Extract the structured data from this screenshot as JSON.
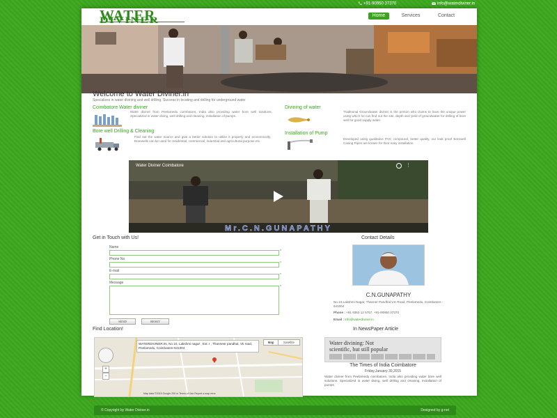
{
  "topbar": {
    "phone": "+91-90950 37370",
    "email": "info@waterdiviner.in",
    "phone_icon": "phone-icon",
    "email_icon": "mail-icon"
  },
  "logo": {
    "line1": "WATER",
    "line2": "DIVINER"
  },
  "nav": [
    {
      "label": "Home",
      "active": true
    },
    {
      "label": "Services",
      "active": false
    },
    {
      "label": "Contact",
      "active": false
    }
  ],
  "welcome": {
    "title": "Welcome to Water Diviner.in",
    "tagline": "Specializes in water divining and well drilling. Success in locating and drilling for underground water"
  },
  "features": [
    {
      "title": "Coimbatore Water diviner",
      "text": "Water diviner from Peelamedu coimbatore, India also providing water bore well solutions. Specialized in water diving, well drilling and cleaning, installation of pumps."
    },
    {
      "title": "Divining of water",
      "text": "Traditional Groundwater diviner is the person who claims to have the unique power using which he can find out the site, depth and yield of groundwater for drilling of bore well for good supply water."
    },
    {
      "title": "Bore well Drilling & Cleaning",
      "text": "Find out the water source and give a better solution to utilize it properly and economically. Borewells can be used for residential, commercial, industrial and agricultural purpose etc."
    },
    {
      "title": "Installation of Pump",
      "text": "Developed using qualitative PVC compound, better quality, our leak proof Borewell Casing Pipes are known for their easy installation."
    }
  ],
  "video": {
    "title": "Water Diviner Coimbatore",
    "caption": "Mr.C.N.GUNAPATHY"
  },
  "contact_form": {
    "heading": "Get in Touch with Us!",
    "name_label": "Name",
    "phone_label": "Phone No",
    "email_label": "E-mail",
    "message_label": "Message",
    "required_mark": "*",
    "send_label": "SEND",
    "reset_label": "RESET"
  },
  "contact_details": {
    "heading": "Contact Details",
    "name": "C.N.GUNAPATHY",
    "address": "No.10,Lakshmi Nagar, Thanner Pandhal,V.K Road, Peelamedu, Coimbatore - 641004",
    "phone_label": "Phone :",
    "phone": "+91 9363 12 5757, +91-90950 37370",
    "email_label": "Email :",
    "email": "info@waterdiviner.in"
  },
  "find_location": {
    "heading": "Find Location!",
    "info": "WATERDIVINER.IN, No 10, Lakshmi nagar , Ext. I , Thanneer pandhal, Vk road, Peelamedu, Coimbatore-641004",
    "map_btn": "Map",
    "satellite_btn": "Satellite",
    "footer": "Map data ©2015 Google  200 m  Terms of Use  Report a map error"
  },
  "newspaper": {
    "heading": "In NewsPaper Article",
    "clip_line1": "Water divining: Not",
    "clip_line2": "scientific, but still popular",
    "title": "The Times of India Coimbatore",
    "date": "Friday,January 30,2015",
    "text": "Water diviner from Peelamedu coimbatore, India also providing water bore well solutions. Specialized in water diving, well drilling and cleaning, installation of pumps."
  },
  "footer": {
    "left": "© Copyright by Water Diviner.in",
    "right": "Designed by g-net"
  }
}
